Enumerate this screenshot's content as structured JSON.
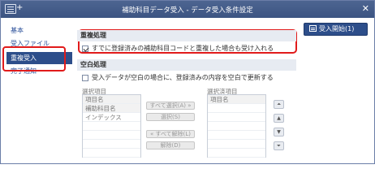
{
  "window": {
    "title": "補助科目データ受入 - データ受入条件設定",
    "plus": "+",
    "close_glyph": "✕"
  },
  "sidebar": {
    "items": [
      {
        "label": "基本"
      },
      {
        "label": "受入ファイル"
      },
      {
        "label": "重複受入"
      },
      {
        "label": "完了通知"
      }
    ]
  },
  "duplicate": {
    "header": "重複処理",
    "checkbox_label": "すでに登録済みの補助科目コードと重複した場合も受け入れる",
    "checked": true
  },
  "blank": {
    "header": "空白処理",
    "checkbox_label": "受入データが空白の場合に、登録済みの内容を空白で更新する",
    "checked": false,
    "available_label": "選択項目",
    "selected_label": "選択済項目",
    "available_items": [
      "項目名",
      "補助科目名",
      "インデックス",
      "",
      "",
      "",
      ""
    ],
    "selected_items": [
      "項目名",
      "",
      "",
      "",
      "",
      "",
      ""
    ],
    "buttons": {
      "select_all": "すべて選択(A) »",
      "select": "選択(S)",
      "deselect_all": "« すべて解除(L)",
      "deselect": "解除(D)"
    }
  },
  "order_buttons": [
    "⏶",
    "▲",
    "▼",
    "⏷"
  ],
  "start_button": {
    "label": "受入開始(1)"
  },
  "colors": {
    "titlebar": "#3f5785",
    "active_item": "#2d4e8a",
    "highlight": "#e11b1b",
    "section_header": "#e7ebf2"
  }
}
